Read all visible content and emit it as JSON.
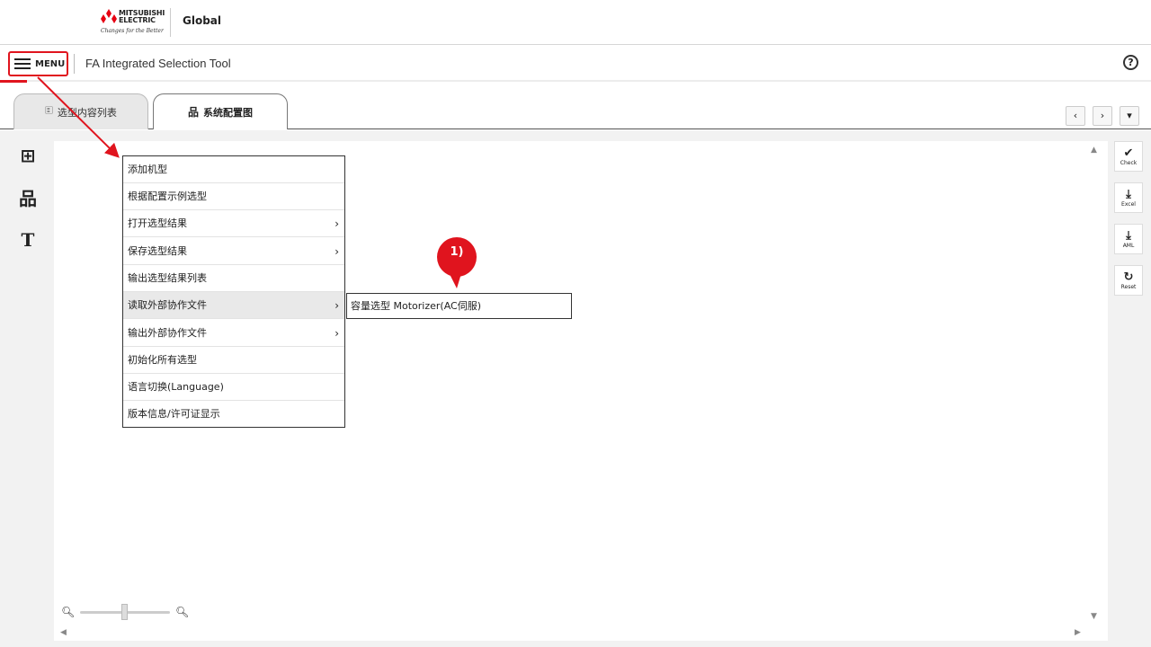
{
  "brand": {
    "logo_line1": "MITSUBISHI",
    "logo_line2": "ELECTRIC",
    "logo_tagline": "Changes for the Better",
    "region_link": "Global"
  },
  "header": {
    "menu_label": "MENU",
    "app_title": "FA Integrated Selection Tool",
    "help_symbol": "?"
  },
  "tabs": [
    {
      "label": "选型内容列表",
      "icon": "list-icon"
    },
    {
      "label": "系统配置图",
      "icon": "hierarchy-icon",
      "selected": true
    }
  ],
  "tab_nav": {
    "prev": "‹",
    "next": "›",
    "dropdown": "▾"
  },
  "left_tools": [
    {
      "name": "add-layer-icon",
      "glyph": "⊞"
    },
    {
      "name": "add-hierarchy-icon",
      "glyph": "品"
    },
    {
      "name": "text-tool-icon",
      "glyph": "T"
    }
  ],
  "right_tools": [
    {
      "label": "Check",
      "glyph": "✔"
    },
    {
      "label": "Excel",
      "glyph": "⤓"
    },
    {
      "label": "AML",
      "glyph": "⤓"
    },
    {
      "label": "Reset",
      "glyph": "↻"
    }
  ],
  "menu": {
    "items": [
      {
        "label": "添加机型",
        "has_submenu": false
      },
      {
        "label": "根据配置示例选型",
        "has_submenu": false
      },
      {
        "label": "打开选型结果",
        "has_submenu": true
      },
      {
        "label": "保存选型结果",
        "has_submenu": true
      },
      {
        "label": "输出选型结果列表",
        "has_submenu": false
      },
      {
        "label": "读取外部协作文件",
        "has_submenu": true,
        "active": true
      },
      {
        "label": "输出外部协作文件",
        "has_submenu": true
      },
      {
        "label": "初始化所有选型",
        "has_submenu": false
      },
      {
        "label": "语言切换(Language)",
        "has_submenu": false
      },
      {
        "label": "版本信息/许可证显示",
        "has_submenu": false
      }
    ],
    "chevron": "›",
    "submenu_item": "容量选型 Motorizer(AC伺服)"
  },
  "annotation": {
    "label": "1)",
    "color": "#e0141e"
  },
  "zoom": {
    "level_fraction": 0.5,
    "out_icon": "zoom-out-icon",
    "in_icon": "zoom-in-icon"
  },
  "colors": {
    "accent": "#e0141e",
    "brand_red": "#e60012"
  }
}
